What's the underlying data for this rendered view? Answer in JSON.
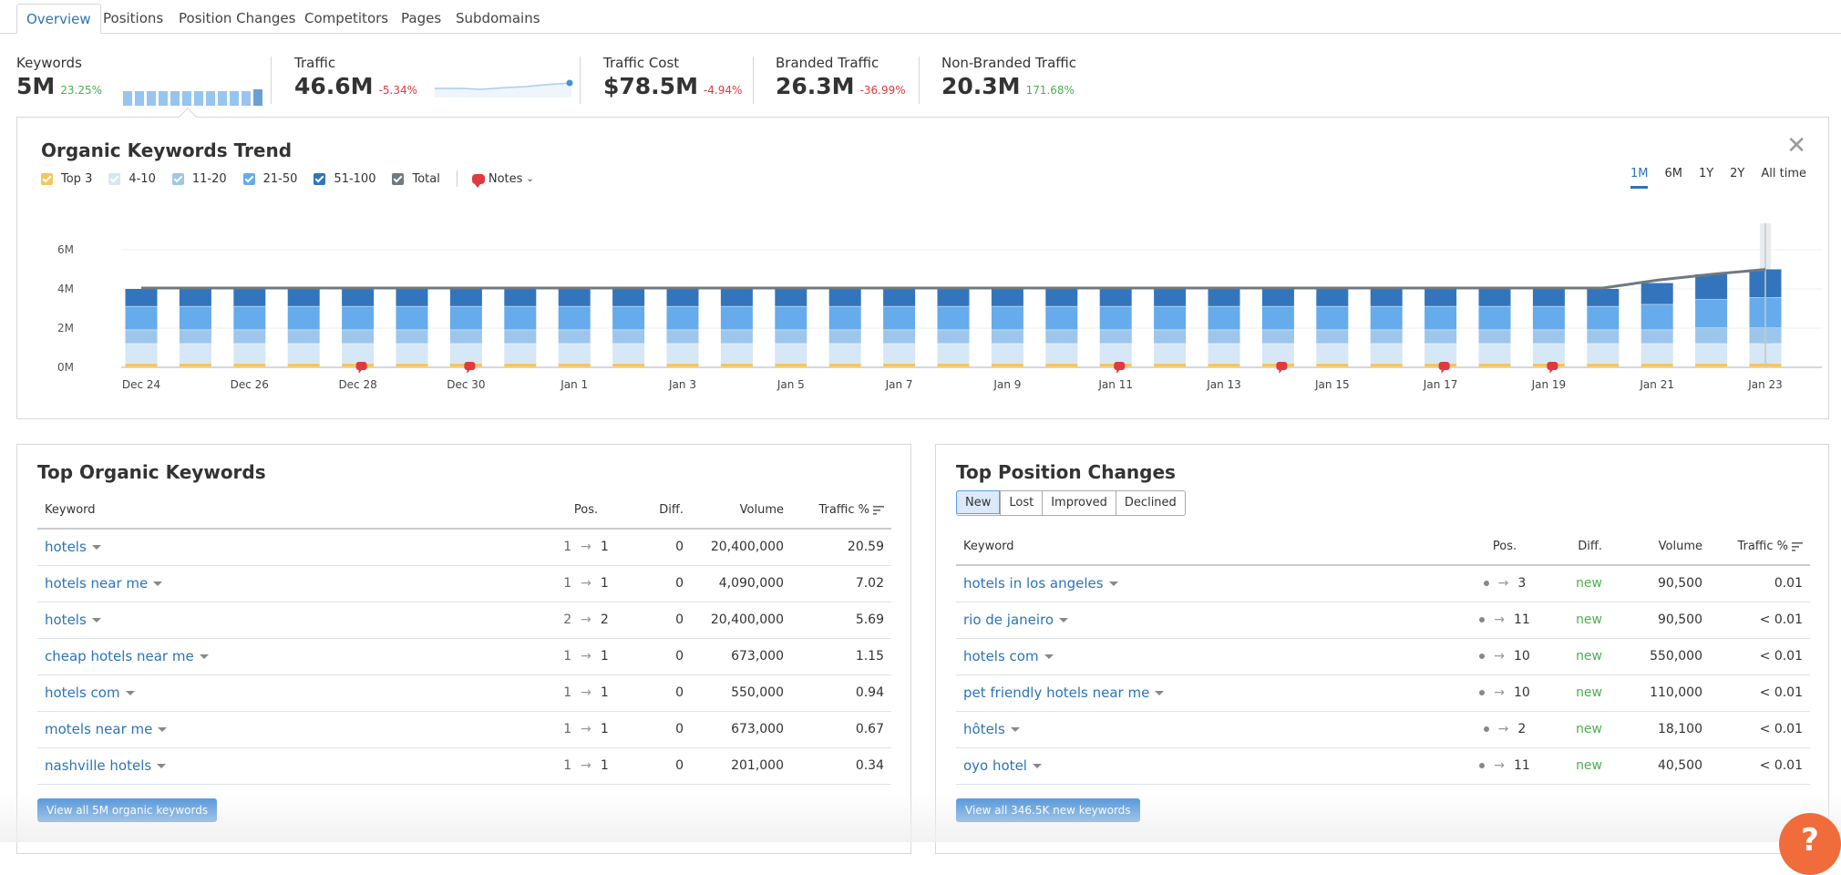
{
  "tabs": [
    {
      "label": "Overview",
      "active": true
    },
    {
      "label": "Positions"
    },
    {
      "label": "Position Changes"
    },
    {
      "label": "Competitors"
    },
    {
      "label": "Pages"
    },
    {
      "label": "Subdomains"
    }
  ],
  "metrics": {
    "keywords": {
      "label": "Keywords",
      "value": "5M",
      "change": "23.25%"
    },
    "traffic": {
      "label": "Traffic",
      "value": "46.6M",
      "change": "-5.34%"
    },
    "traffic_cost": {
      "label": "Traffic Cost",
      "value": "$78.5M",
      "change": "-4.94%"
    },
    "branded": {
      "label": "Branded Traffic",
      "value": "26.3M",
      "change": "-36.99%"
    },
    "non_branded": {
      "label": "Non-Branded Traffic",
      "value": "20.3M",
      "change": "171.68%"
    }
  },
  "trend": {
    "title": "Organic Keywords Trend",
    "legend": [
      {
        "label": "Top 3",
        "color": "#f6c65b"
      },
      {
        "label": "4-10",
        "color": "#d6e7f7"
      },
      {
        "label": "11-20",
        "color": "#9dc6ec"
      },
      {
        "label": "21-50",
        "color": "#66abeb"
      },
      {
        "label": "51-100",
        "color": "#3375bc"
      },
      {
        "label": "Total",
        "color": "#6f7a80"
      }
    ],
    "notes_label": "Notes",
    "periods": [
      "1M",
      "6M",
      "1Y",
      "2Y",
      "All time"
    ],
    "active_period": "1M"
  },
  "chart_data": {
    "type": "bar",
    "stacked": true,
    "title": "Organic Keywords Trend",
    "categories": [
      "Dec 24",
      "Dec 25",
      "Dec 26",
      "Dec 27",
      "Dec 28",
      "Dec 29",
      "Dec 30",
      "Dec 31",
      "Jan 1",
      "Jan 2",
      "Jan 3",
      "Jan 4",
      "Jan 5",
      "Jan 6",
      "Jan 7",
      "Jan 8",
      "Jan 9",
      "Jan 10",
      "Jan 11",
      "Jan 12",
      "Jan 13",
      "Jan 14",
      "Jan 15",
      "Jan 16",
      "Jan 17",
      "Jan 18",
      "Jan 19",
      "Jan 20",
      "Jan 21",
      "Jan 22",
      "Jan 23"
    ],
    "tick_labels": [
      "Dec 24",
      "Dec 26",
      "Dec 28",
      "Dec 30",
      "Jan 1",
      "Jan 3",
      "Jan 5",
      "Jan 7",
      "Jan 9",
      "Jan 11",
      "Jan 13",
      "Jan 15",
      "Jan 17",
      "Jan 19",
      "Jan 21",
      "Jan 23"
    ],
    "y_ticks": [
      "0M",
      "2M",
      "4M",
      "6M"
    ],
    "ylim": [
      0,
      6000000
    ],
    "series": [
      {
        "name": "Top 3",
        "values": [
          200000,
          200000,
          200000,
          200000,
          200000,
          200000,
          200000,
          200000,
          200000,
          200000,
          200000,
          200000,
          200000,
          200000,
          200000,
          200000,
          200000,
          200000,
          200000,
          200000,
          200000,
          200000,
          200000,
          200000,
          200000,
          200000,
          200000,
          200000,
          200000,
          200000,
          200000
        ]
      },
      {
        "name": "4-10",
        "values": [
          1000000,
          1000000,
          1000000,
          1000000,
          1000000,
          1000000,
          1000000,
          1000000,
          1000000,
          1000000,
          1000000,
          1000000,
          1000000,
          1000000,
          1000000,
          1000000,
          1000000,
          1000000,
          1000000,
          1000000,
          1000000,
          1000000,
          1000000,
          1000000,
          1000000,
          1000000,
          1000000,
          1000000,
          1000000,
          1000000,
          1000000
        ]
      },
      {
        "name": "11-20",
        "values": [
          700000,
          700000,
          700000,
          700000,
          700000,
          700000,
          700000,
          700000,
          700000,
          700000,
          700000,
          700000,
          700000,
          700000,
          700000,
          700000,
          700000,
          700000,
          700000,
          700000,
          700000,
          700000,
          700000,
          700000,
          700000,
          700000,
          700000,
          700000,
          700000,
          800000,
          800000
        ]
      },
      {
        "name": "21-50",
        "values": [
          1200000,
          1200000,
          1200000,
          1200000,
          1200000,
          1200000,
          1200000,
          1200000,
          1200000,
          1200000,
          1200000,
          1200000,
          1200000,
          1200000,
          1200000,
          1200000,
          1200000,
          1200000,
          1200000,
          1200000,
          1200000,
          1200000,
          1200000,
          1200000,
          1200000,
          1200000,
          1200000,
          1200000,
          1300000,
          1450000,
          1550000
        ]
      },
      {
        "name": "51-100",
        "values": [
          900000,
          900000,
          900000,
          900000,
          900000,
          900000,
          900000,
          900000,
          900000,
          900000,
          900000,
          900000,
          900000,
          900000,
          900000,
          900000,
          900000,
          900000,
          900000,
          900000,
          900000,
          900000,
          900000,
          900000,
          900000,
          900000,
          900000,
          900000,
          1100000,
          1300000,
          1450000
        ]
      }
    ],
    "total": [
      4000000,
      4000000,
      4000000,
      4000000,
      4000000,
      4000000,
      4000000,
      4000000,
      4000000,
      4000000,
      4000000,
      4000000,
      4000000,
      4000000,
      4000000,
      4000000,
      4000000,
      4000000,
      4000000,
      4000000,
      4000000,
      4000000,
      4000000,
      4000000,
      4000000,
      4000000,
      4000000,
      4000000,
      4400000,
      4700000,
      4950000
    ],
    "notes_on": [
      "Dec 28",
      "Dec 30",
      "Jan 11",
      "Jan 14",
      "Jan 17",
      "Jan 19"
    ],
    "grid": true,
    "highlighted": "Jan 23"
  },
  "top_keywords": {
    "title": "Top Organic Keywords",
    "columns": [
      "Keyword",
      "Pos.",
      "Diff.",
      "Volume",
      "Traffic %"
    ],
    "rows": [
      {
        "keyword": "hotels",
        "from": "1",
        "to": "1",
        "diff": "0",
        "volume": "20,400,000",
        "traffic": "20.59"
      },
      {
        "keyword": "hotels near me",
        "from": "1",
        "to": "1",
        "diff": "0",
        "volume": "4,090,000",
        "traffic": "7.02"
      },
      {
        "keyword": "hotels",
        "from": "2",
        "to": "2",
        "diff": "0",
        "volume": "20,400,000",
        "traffic": "5.69"
      },
      {
        "keyword": "cheap hotels near me",
        "from": "1",
        "to": "1",
        "diff": "0",
        "volume": "673,000",
        "traffic": "1.15"
      },
      {
        "keyword": "hotels com",
        "from": "1",
        "to": "1",
        "diff": "0",
        "volume": "550,000",
        "traffic": "0.94"
      },
      {
        "keyword": "motels near me",
        "from": "1",
        "to": "1",
        "diff": "0",
        "volume": "673,000",
        "traffic": "0.67"
      },
      {
        "keyword": "nashville hotels",
        "from": "1",
        "to": "1",
        "diff": "0",
        "volume": "201,000",
        "traffic": "0.34"
      }
    ],
    "button": "View all 5M organic keywords"
  },
  "position_changes": {
    "title": "Top Position Changes",
    "filters": [
      "New",
      "Lost",
      "Improved",
      "Declined"
    ],
    "active_filter": "New",
    "columns": [
      "Keyword",
      "Pos.",
      "Diff.",
      "Volume",
      "Traffic %"
    ],
    "rows": [
      {
        "keyword": "hotels in los angeles",
        "to": "3",
        "diff": "new",
        "volume": "90,500",
        "traffic": "0.01"
      },
      {
        "keyword": "rio de janeiro",
        "to": "11",
        "diff": "new",
        "volume": "90,500",
        "traffic": "< 0.01"
      },
      {
        "keyword": "hotels com",
        "to": "10",
        "diff": "new",
        "volume": "550,000",
        "traffic": "< 0.01"
      },
      {
        "keyword": "pet friendly hotels near me",
        "to": "10",
        "diff": "new",
        "volume": "110,000",
        "traffic": "< 0.01"
      },
      {
        "keyword": "hôtels",
        "to": "2",
        "diff": "new",
        "volume": "18,100",
        "traffic": "< 0.01"
      },
      {
        "keyword": "oyo hotel",
        "to": "11",
        "diff": "new",
        "volume": "40,500",
        "traffic": "< 0.01"
      }
    ],
    "button": "View all 346.5K new keywords"
  },
  "help_label": "?"
}
